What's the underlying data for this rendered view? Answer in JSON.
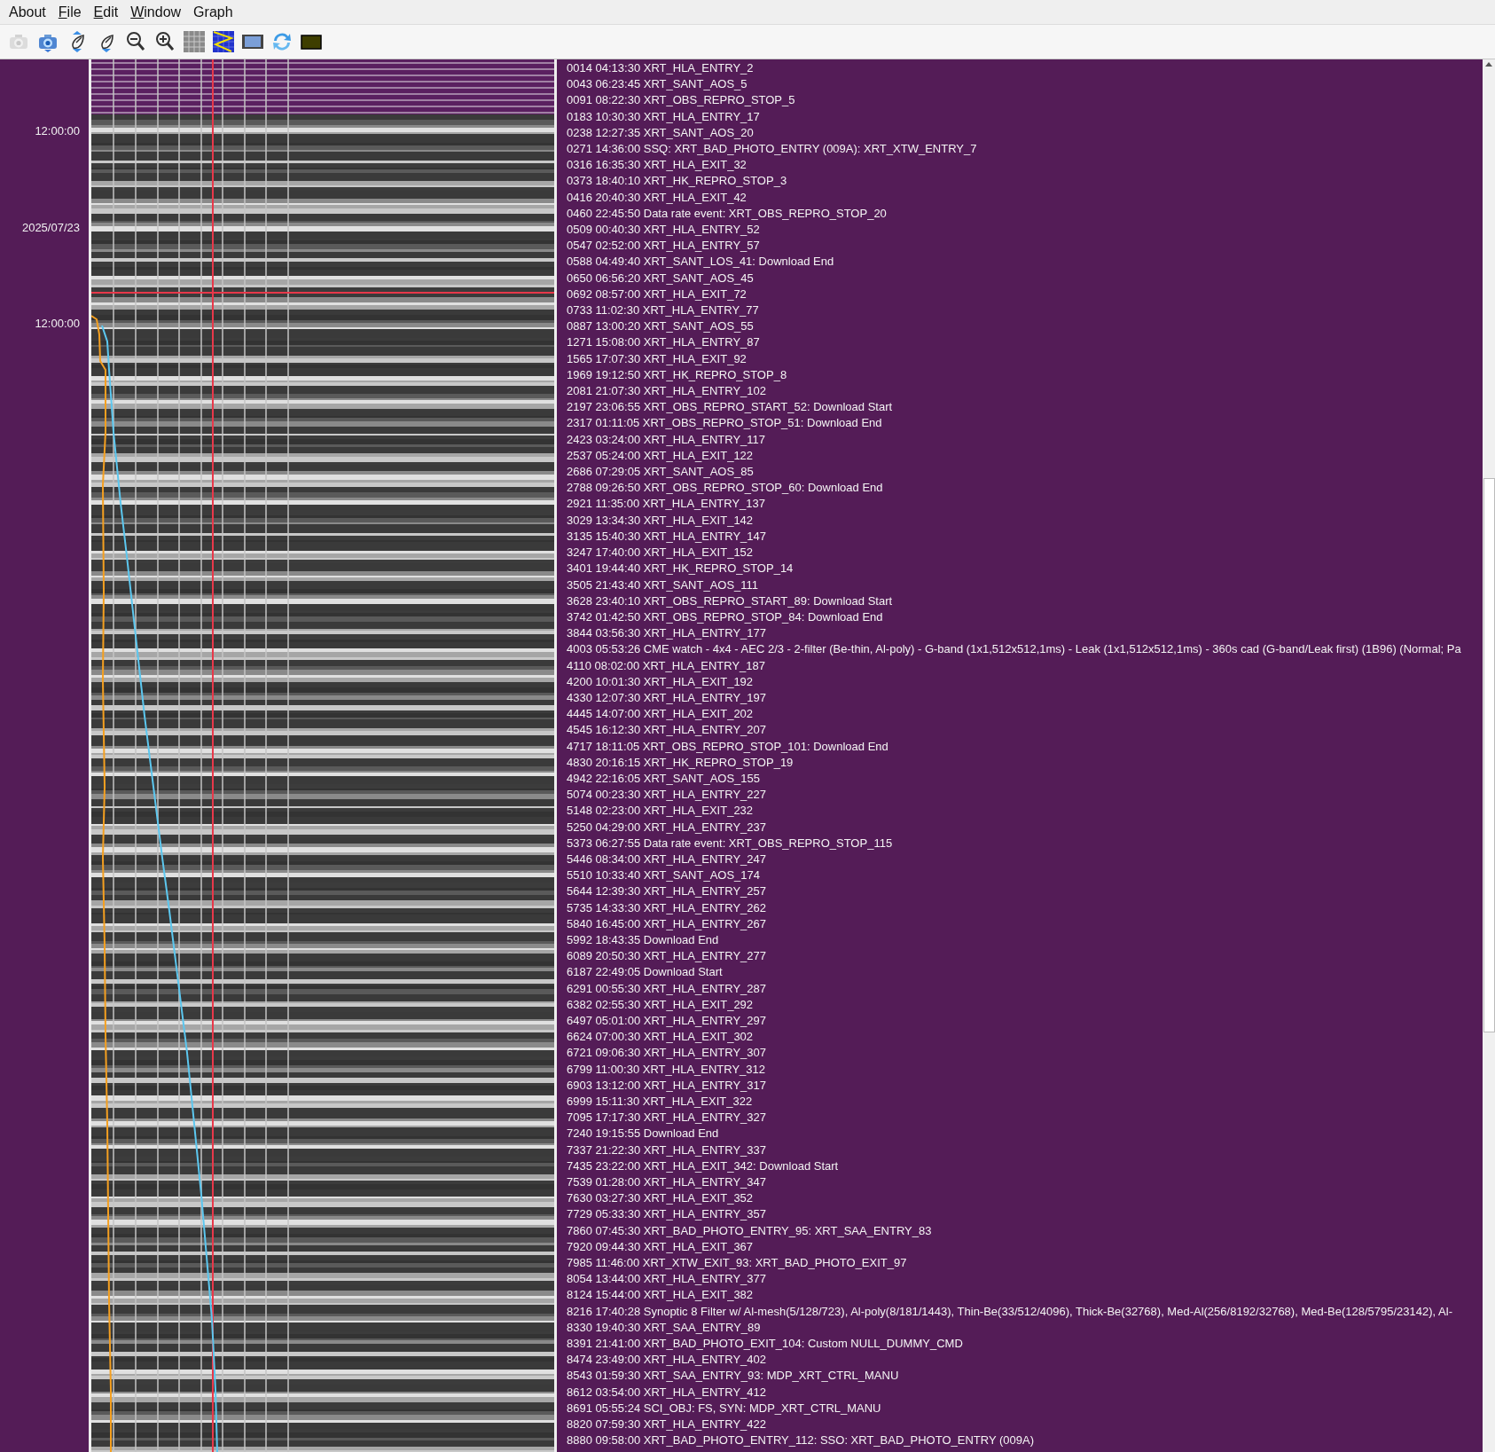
{
  "menu": [
    {
      "label": "About",
      "mnemonic": false
    },
    {
      "label": "File",
      "mnemonic": true
    },
    {
      "label": "Edit",
      "mnemonic": true
    },
    {
      "label": "Window",
      "mnemonic": true
    },
    {
      "label": "Graph",
      "mnemonic": false
    }
  ],
  "toolbar": [
    {
      "kind": "camera",
      "disabled": true
    },
    {
      "kind": "camera",
      "disabled": false
    },
    {
      "kind": "dish-updown",
      "disabled": false
    },
    {
      "kind": "dish-down",
      "disabled": false
    },
    {
      "kind": "zoom-out",
      "disabled": false
    },
    {
      "kind": "zoom-in",
      "disabled": false
    },
    {
      "kind": "grid",
      "disabled": false
    },
    {
      "kind": "zigzag",
      "disabled": false
    },
    {
      "kind": "film",
      "disabled": false
    },
    {
      "kind": "refresh",
      "disabled": false
    },
    {
      "kind": "swatch",
      "disabled": false
    }
  ],
  "time_axis": {
    "labels": [
      "12:00:00",
      "2025/07/23",
      "12:00:00"
    ]
  },
  "events": [
    "0014 04:13:30 XRT_HLA_ENTRY_2",
    "0043 06:23:45 XRT_SANT_AOS_5",
    "0091 08:22:30 XRT_OBS_REPRO_STOP_5",
    "0183 10:30:30 XRT_HLA_ENTRY_17",
    "0238 12:27:35 XRT_SANT_AOS_20",
    "0271 14:36:00 SSQ: XRT_BAD_PHOTO_ENTRY (009A): XRT_XTW_ENTRY_7",
    "0316 16:35:30 XRT_HLA_EXIT_32",
    "0373 18:40:10 XRT_HK_REPRO_STOP_3",
    "0416 20:40:30 XRT_HLA_EXIT_42",
    "0460 22:45:50 Data rate event: XRT_OBS_REPRO_STOP_20",
    "0509 00:40:30 XRT_HLA_ENTRY_52",
    "0547 02:52:00 XRT_HLA_ENTRY_57",
    "0588 04:49:40 XRT_SANT_LOS_41: Download End",
    "0650 06:56:20 XRT_SANT_AOS_45",
    "0692 08:57:00 XRT_HLA_EXIT_72",
    "0733 11:02:30 XRT_HLA_ENTRY_77",
    "0887 13:00:20 XRT_SANT_AOS_55",
    "1271 15:08:00 XRT_HLA_ENTRY_87",
    "1565 17:07:30 XRT_HLA_EXIT_92",
    "1969 19:12:50 XRT_HK_REPRO_STOP_8",
    "2081 21:07:30 XRT_HLA_ENTRY_102",
    "2197 23:06:55 XRT_OBS_REPRO_START_52: Download Start",
    "2317 01:11:05 XRT_OBS_REPRO_STOP_51: Download End",
    "2423 03:24:00 XRT_HLA_ENTRY_117",
    "2537 05:24:00 XRT_HLA_EXIT_122",
    "2686 07:29:05 XRT_SANT_AOS_85",
    "2788 09:26:50 XRT_OBS_REPRO_STOP_60: Download End",
    "2921 11:35:00 XRT_HLA_ENTRY_137",
    "3029 13:34:30 XRT_HLA_EXIT_142",
    "3135 15:40:30 XRT_HLA_ENTRY_147",
    "3247 17:40:00 XRT_HLA_EXIT_152",
    "3401 19:44:40 XRT_HK_REPRO_STOP_14",
    "3505 21:43:40 XRT_SANT_AOS_111",
    "3628 23:40:10 XRT_OBS_REPRO_START_89: Download Start",
    "3742 01:42:50 XRT_OBS_REPRO_STOP_84: Download End",
    "3844 03:56:30 XRT_HLA_ENTRY_177",
    "4003 05:53:26 CME watch - 4x4 - AEC 2/3 - 2-filter (Be-thin, Al-poly) - G-band (1x1,512x512,1ms) - Leak (1x1,512x512,1ms) - 360s cad (G-band/Leak first) (1B96) (Normal; Pa",
    "4110 08:02:00 XRT_HLA_ENTRY_187",
    "4200 10:01:30 XRT_HLA_EXIT_192",
    "4330 12:07:30 XRT_HLA_ENTRY_197",
    "4445 14:07:00 XRT_HLA_EXIT_202",
    "4545 16:12:30 XRT_HLA_ENTRY_207",
    "4717 18:11:05 XRT_OBS_REPRO_STOP_101: Download End",
    "4830 20:16:15 XRT_HK_REPRO_STOP_19",
    "4942 22:16:05 XRT_SANT_AOS_155",
    "5074 00:23:30 XRT_HLA_ENTRY_227",
    "5148 02:23:00 XRT_HLA_EXIT_232",
    "5250 04:29:00 XRT_HLA_ENTRY_237",
    "5373 06:27:55 Data rate event: XRT_OBS_REPRO_STOP_115",
    "5446 08:34:00 XRT_HLA_ENTRY_247",
    "5510 10:33:40 XRT_SANT_AOS_174",
    "5644 12:39:30 XRT_HLA_ENTRY_257",
    "5735 14:33:30 XRT_HLA_ENTRY_262",
    "5840 16:45:00 XRT_HLA_ENTRY_267",
    "5992 18:43:35 Download End",
    "6089 20:50:30 XRT_HLA_ENTRY_277",
    "6187 22:49:05 Download Start",
    "6291 00:55:30 XRT_HLA_ENTRY_287",
    "6382 02:55:30 XRT_HLA_EXIT_292",
    "6497 05:01:00 XRT_HLA_ENTRY_297",
    "6624 07:00:30 XRT_HLA_EXIT_302",
    "6721 09:06:30 XRT_HLA_ENTRY_307",
    "6799 11:00:30 XRT_HLA_ENTRY_312",
    "6903 13:12:00 XRT_HLA_ENTRY_317",
    "6999 15:11:30 XRT_HLA_EXIT_322",
    "7095 17:17:30 XRT_HLA_ENTRY_327",
    "7240 19:15:55 Download End",
    "7337 21:22:30 XRT_HLA_ENTRY_337",
    "7435 23:22:00 XRT_HLA_EXIT_342: Download Start",
    "7539 01:28:00 XRT_HLA_ENTRY_347",
    "7630 03:27:30 XRT_HLA_EXIT_352",
    "7729 05:33:30 XRT_HLA_ENTRY_357",
    "7860 07:45:30 XRT_BAD_PHOTO_ENTRY_95: XRT_SAA_ENTRY_83",
    "7920 09:44:30 XRT_HLA_EXIT_367",
    "7985 11:46:00 XRT_XTW_EXIT_93: XRT_BAD_PHOTO_EXIT_97",
    "8054 13:44:00 XRT_HLA_ENTRY_377",
    "8124 15:44:00 XRT_HLA_EXIT_382",
    "8216 17:40:28 Synoptic 8 Filter w/ Al-mesh(5/128/723), Al-poly(8/181/1443), Thin-Be(33/512/4096), Thick-Be(32768), Med-Al(256/8192/32768), Med-Be(128/5795/23142), Al-",
    "8330 19:40:30 XRT_SAA_ENTRY_89",
    "8391 21:41:00 XRT_BAD_PHOTO_EXIT_104: Custom NULL_DUMMY_CMD",
    "8474 23:49:00 XRT_HLA_ENTRY_402",
    "8543 01:59:30 XRT_SAA_ENTRY_93: MDP_XRT_CTRL_MANU",
    "8612 03:54:00 XRT_HLA_ENTRY_412",
    "8691 05:55:24 SCI_OBJ: FS, SYN: MDP_XRT_CTRL_MANU",
    "8820 07:59:30 XRT_HLA_ENTRY_422",
    "8880 09:58:00 XRT_BAD_PHOTO_ENTRY_112: SSO: XRT_BAD_PHOTO_ENTRY (009A)"
  ]
}
